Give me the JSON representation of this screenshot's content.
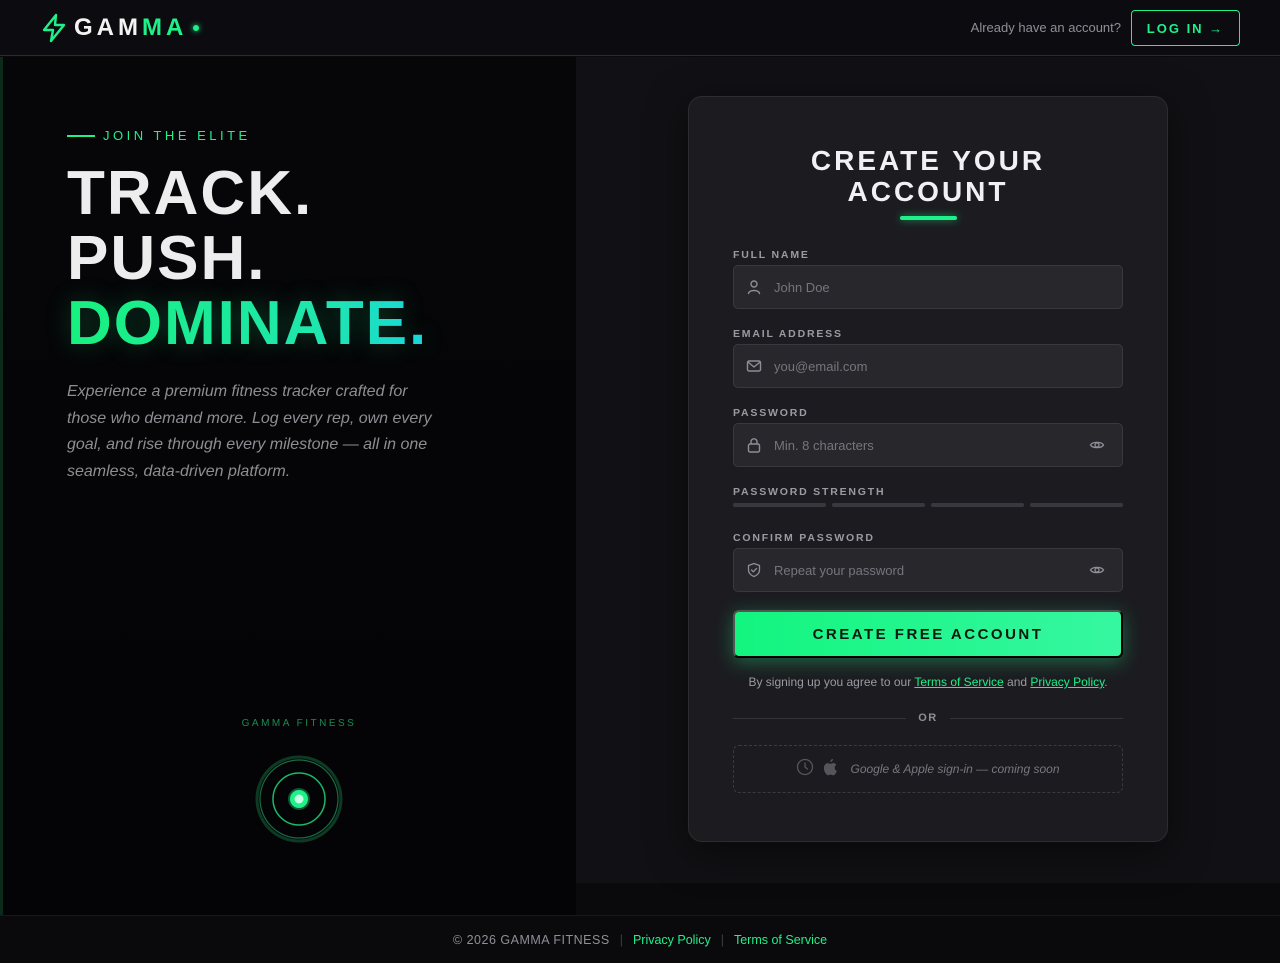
{
  "colors": {
    "accent": "#1ef08a",
    "background": "#0a0a0d",
    "card": "#1c1c20"
  },
  "header": {
    "logo_a": "GAM",
    "logo_b": "MA",
    "logo_icon": "lightning-bolt-icon",
    "have_account": "Already have an account?",
    "login_label": "LOG IN →"
  },
  "hero": {
    "eyebrow": "JOIN THE ELITE",
    "line1": "TRACK.",
    "line2": "PUSH.",
    "line3": "DOMINATE.",
    "description": "Experience a premium fitness tracker crafted for those who demand more. Log every rep, own every goal, and rise through every milestone — all in one seamless, data-driven platform.",
    "brand_caption": "GAMMA FITNESS"
  },
  "form": {
    "title_line1": "CREATE YOUR",
    "title_line2": "ACCOUNT",
    "full_name": {
      "label": "FULL NAME",
      "placeholder": "John Doe",
      "value": "",
      "icon": "user-icon"
    },
    "email": {
      "label": "EMAIL ADDRESS",
      "placeholder": "you@email.com",
      "value": "",
      "icon": "mail-icon"
    },
    "password": {
      "label": "PASSWORD",
      "placeholder": "Min. 8 characters",
      "value": "",
      "icon": "lock-icon"
    },
    "strength": {
      "label": "PASSWORD STRENGTH",
      "level": 0,
      "segments": 4
    },
    "confirm": {
      "label": "CONFIRM PASSWORD",
      "placeholder": "Repeat your password",
      "value": "",
      "icon": "shield-check-icon"
    },
    "submit_label": "CREATE FREE ACCOUNT",
    "legal_prefix": "By signing up you agree to our",
    "terms": "Terms of Service",
    "and": "and",
    "privacy": "Privacy Policy",
    "legal_suffix": ".",
    "or": "OR",
    "social_text": "Google & Apple sign-in — coming soon"
  },
  "footer": {
    "copyright": "© 2026 GAMMA FITNESS",
    "privacy": "Privacy Policy",
    "terms": "Terms of Service"
  }
}
